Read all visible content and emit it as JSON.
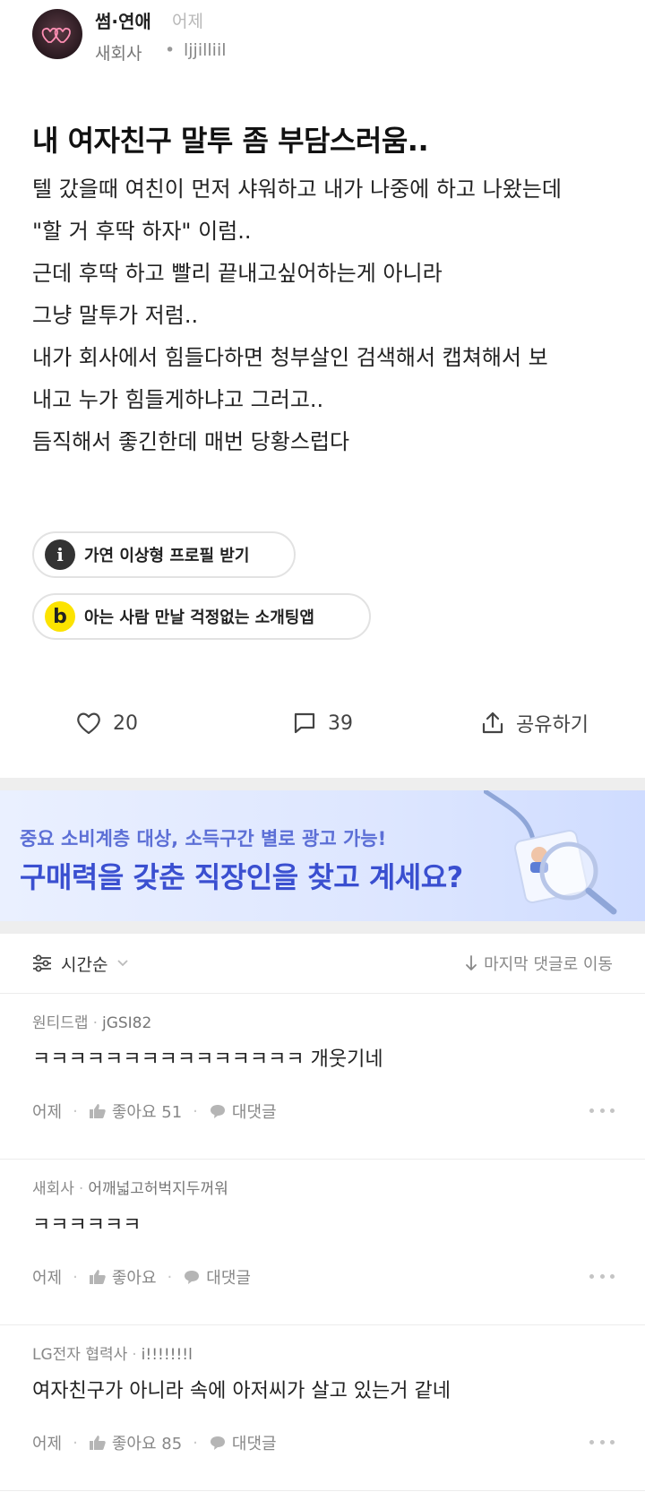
{
  "post": {
    "channel": "썸·연애",
    "time": "어제",
    "company": "새회사",
    "separator": "•",
    "author": "ljjilliil",
    "title": "내 여자친구 말투 좀 부담스러움..",
    "body_lines": [
      "텔 갔을때 여친이 먼저 샤워하고 내가 나중에 하고 나왔는데",
      "\"할 거 후딱 하자\" 이럼..",
      "근데 후딱 하고 빨리 끝내고싶어하는게 아니라",
      "그냥 말투가 저럼..",
      "내가 회사에서 힘들다하면 청부살인 검색해서 캡쳐해서 보",
      "내고 누가 힘들게하냐고 그러고..",
      "듬직해서 좋긴한데 매번 당황스럽다"
    ]
  },
  "chips": [
    {
      "icon_glyph": "i",
      "icon": "info-icon",
      "label": "가연 이상형 프로필 받기"
    },
    {
      "icon_glyph": "b",
      "icon": "b-logo-icon",
      "label": "아는 사람 만날 걱정없는 소개팅앱"
    }
  ],
  "actions": {
    "like_count": "20",
    "comment_count": "39",
    "share_label": "공유하기"
  },
  "ad": {
    "sub": "중요 소비계층 대상, 소득구간 별로 광고 가능!",
    "main": "구매력을 갖춘 직장인을 찾고 계세요?"
  },
  "sort": {
    "label": "시간순",
    "jump_label": "마지막 댓글로 이동"
  },
  "comments": [
    {
      "company": "원티드랩",
      "author": "jGSI82",
      "text": "ㅋㅋㅋㅋㅋㅋㅋㅋㅋㅋㅋㅋㅋㅋㅋ 개웃기네",
      "time": "어제",
      "like_label": "좋아요 51",
      "reply_label": "대댓글"
    },
    {
      "company": "새회사",
      "author": "어깨넓고허벅지두꺼워",
      "text": "ㅋㅋㅋㅋㅋㅋ",
      "time": "어제",
      "like_label": "좋아요",
      "reply_label": "대댓글"
    },
    {
      "company": "LG전자 협력사",
      "author": "i!!!!!!!l",
      "text": "여자친구가 아니라 속에 아저씨가 살고 있는거 같네",
      "time": "어제",
      "like_label": "좋아요 85",
      "reply_label": "대댓글"
    }
  ],
  "colors": {
    "ad_accent": "#3a4fd0",
    "chip_yellow": "#fce300",
    "muted": "#888888"
  }
}
